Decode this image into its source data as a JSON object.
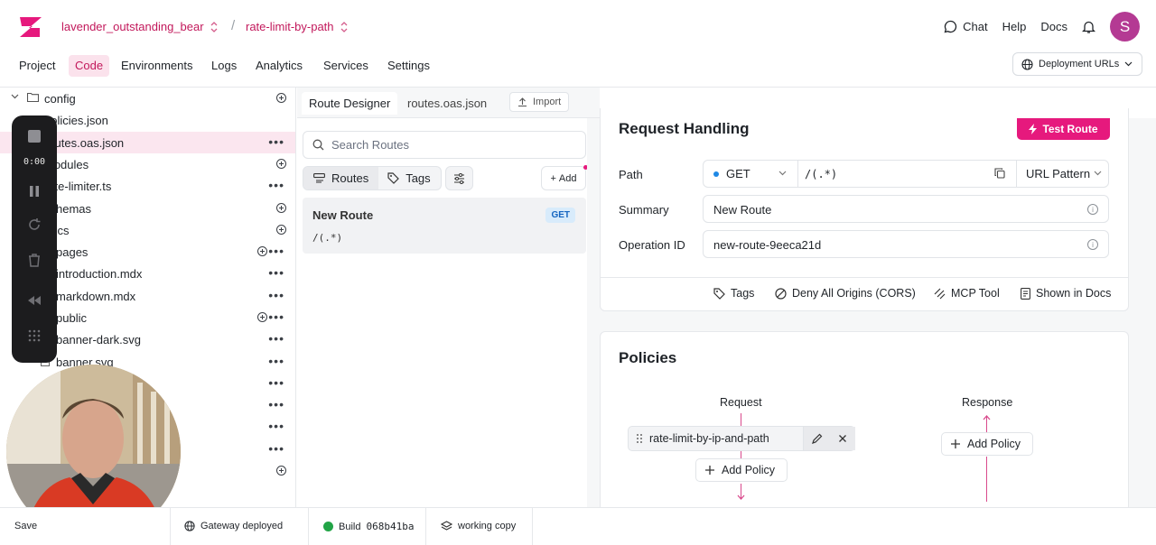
{
  "header": {
    "project": "lavender_outstanding_bear",
    "branch": "rate-limit-by-path",
    "links": {
      "chat": "Chat",
      "help": "Help",
      "docs": "Docs"
    },
    "avatar_initial": "S"
  },
  "nav": {
    "items": [
      "Project",
      "Code",
      "Environments",
      "Logs",
      "Analytics",
      "Services",
      "Settings"
    ],
    "active": "Code",
    "deployment_urls": "Deployment URLs"
  },
  "tree": {
    "items": [
      {
        "label": "config",
        "action": "plus"
      },
      {
        "label": "policies.json",
        "action": ""
      },
      {
        "label": "routes.oas.json",
        "action": "dots"
      },
      {
        "label": "modules",
        "action": "plus"
      },
      {
        "label": "rate-limiter.ts",
        "action": "dots"
      },
      {
        "label": "schemas",
        "action": "plus"
      },
      {
        "label": "docs",
        "action": "plus"
      },
      {
        "label": "pages",
        "action": "plusdots"
      },
      {
        "label": "introduction.mdx",
        "action": "dots"
      },
      {
        "label": "markdown.mdx",
        "action": "dots"
      },
      {
        "label": "public",
        "action": "plusdots"
      },
      {
        "label": "banner-dark.svg",
        "action": "dots"
      },
      {
        "label": "banner.svg",
        "action": "dots"
      }
    ]
  },
  "recording": {
    "time": "0:00"
  },
  "middle": {
    "tabs": {
      "designer": "Route Designer",
      "file": "routes.oas.json",
      "import": "Import"
    },
    "search_placeholder": "Search Routes",
    "seg": {
      "routes": "Routes",
      "tags": "Tags"
    },
    "add": "Add",
    "route": {
      "name": "New Route",
      "method": "GET",
      "path": "/(.*)"
    }
  },
  "request": {
    "title": "Request Handling",
    "test_button": "Test Route",
    "labels": {
      "path": "Path",
      "summary": "Summary",
      "operation_id": "Operation ID"
    },
    "method": "GET",
    "path": "/(.*)",
    "pattern_type": "URL Pattern",
    "summary": "New Route",
    "operation_id": "new-route-9eeca21d",
    "toggles": {
      "tags": "Tags",
      "cors": "Deny All Origins (CORS)",
      "mcp": "MCP Tool",
      "docs": "Shown in Docs"
    }
  },
  "policies": {
    "title": "Policies",
    "request_label": "Request",
    "response_label": "Response",
    "request_policy": "rate-limit-by-ip-and-path",
    "add_policy": "Add Policy"
  },
  "status": {
    "save": "Save",
    "gateway": "Gateway deployed",
    "build_label": "Build",
    "build_hash": "068b41ba",
    "working": "working copy",
    "status_color": "#22a447"
  },
  "colors": {
    "accent": "#e6197d",
    "brand": "#c2185b"
  }
}
